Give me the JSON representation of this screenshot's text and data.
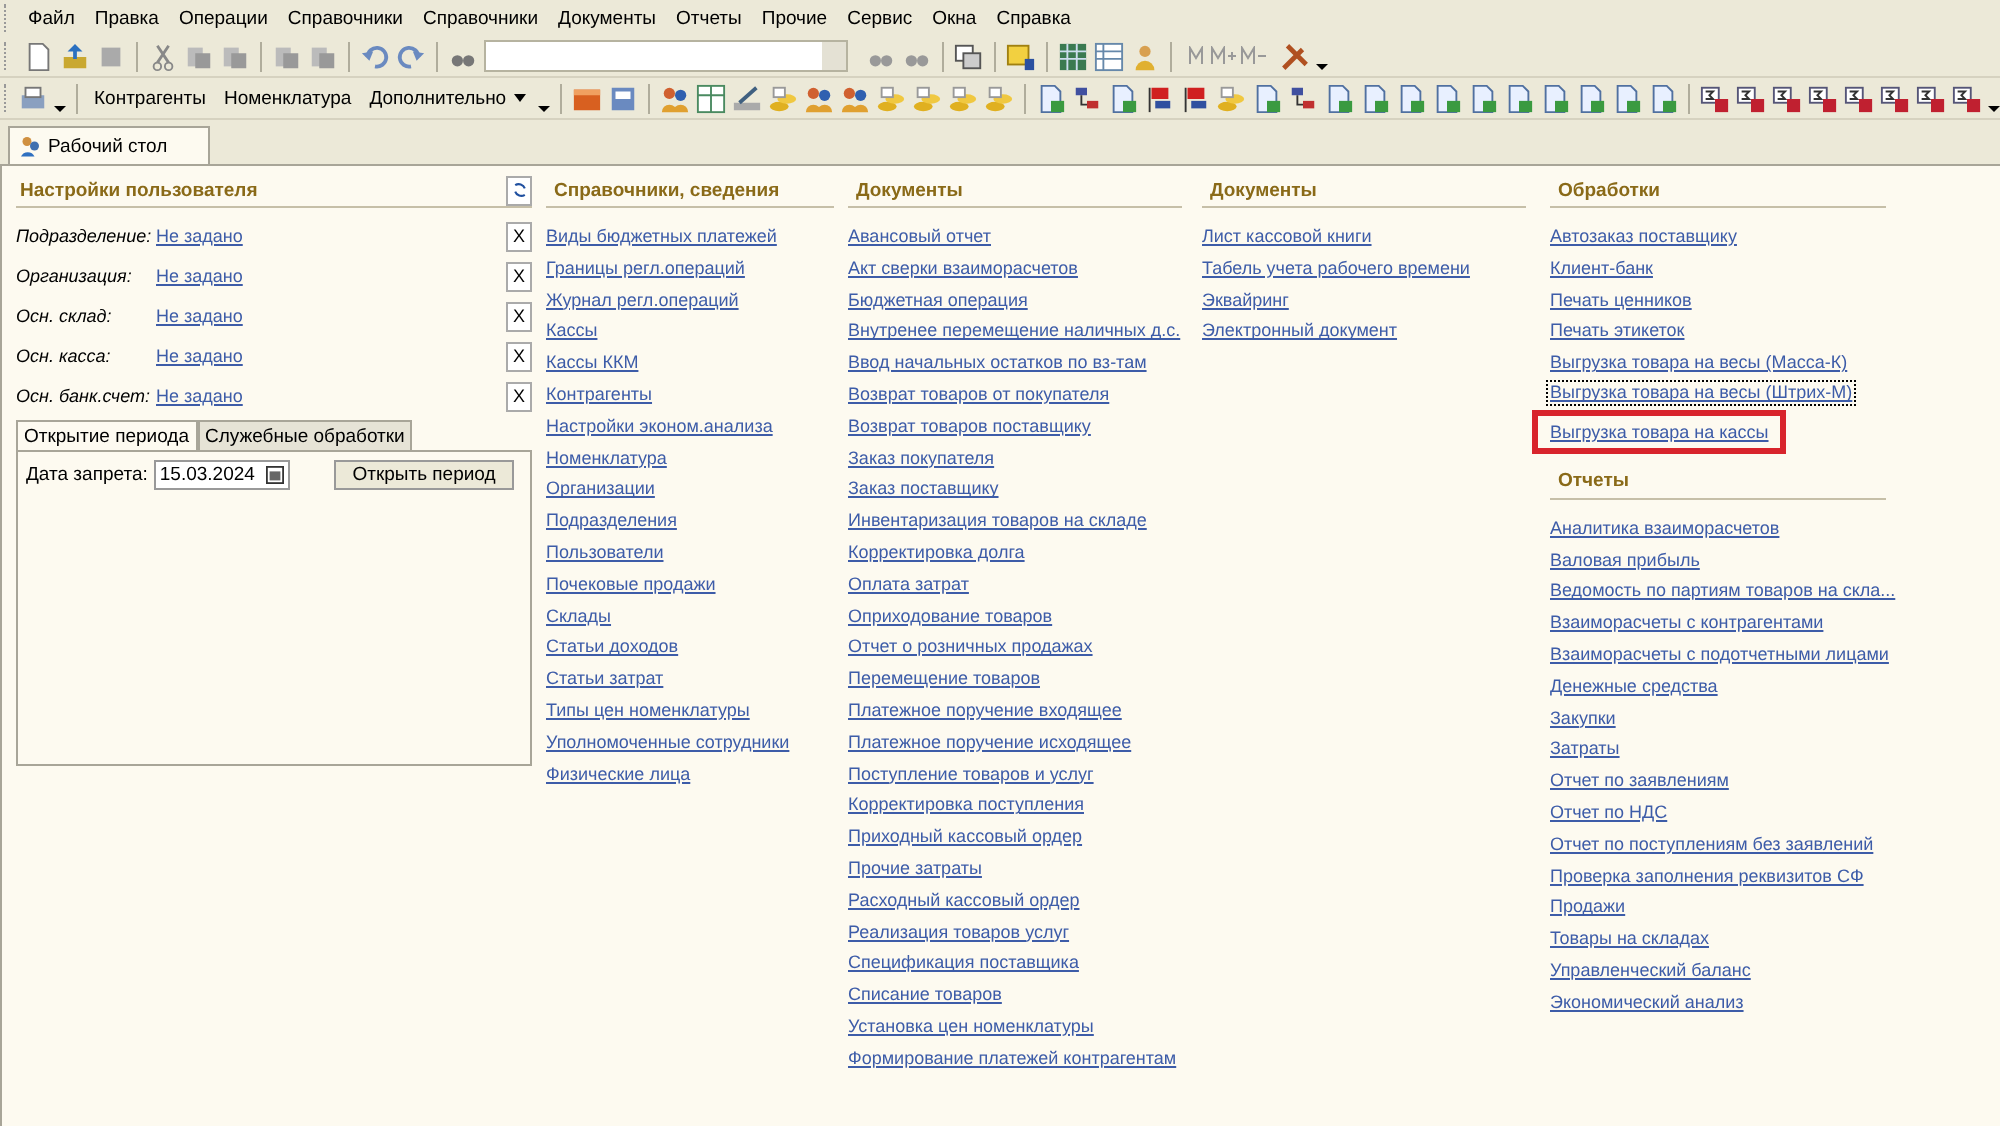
{
  "menu": [
    {
      "label": "Файл"
    },
    {
      "label": "Правка"
    },
    {
      "label": "Операции"
    },
    {
      "label": "Справочники"
    },
    {
      "label": "Справочники"
    },
    {
      "label": "Документы"
    },
    {
      "label": "Отчеты"
    },
    {
      "label": "Прочие"
    },
    {
      "label": "Сервис"
    },
    {
      "label": "Окна"
    },
    {
      "label": "Справка"
    }
  ],
  "quick_buttons": [
    "Контрагенты",
    "Номенклатура",
    "Дополнительно"
  ],
  "tabs": [
    {
      "label": "Рабочий стол",
      "selected": true
    }
  ],
  "user_settings": {
    "title": "Настройки пользователя",
    "fields": [
      {
        "label": "Подразделение:",
        "value": "Не задано",
        "clear": "X"
      },
      {
        "label": "Организация:",
        "value": "Не задано",
        "clear": "X"
      },
      {
        "label": "Осн. склад:",
        "value": "Не задано",
        "clear": "X"
      },
      {
        "label": "Осн. касса:",
        "value": "Не задано",
        "clear": "X"
      },
      {
        "label": "Осн. банк.счет:",
        "value": "Не задано",
        "clear": "X"
      }
    ],
    "inner_tabs": [
      {
        "label": "Открытие периода",
        "selected": true
      },
      {
        "label": "Служебные обработки",
        "selected": false
      }
    ],
    "date_label": "Дата запрета:",
    "date_value": "15.03.2024",
    "open_button": "Открыть период"
  },
  "columns": [
    {
      "sections": [
        {
          "title": "Справочники, сведения",
          "items": [
            {
              "label": "Виды бюджетных платежей"
            },
            {
              "label": "Границы регл.операций"
            },
            {
              "label": "Журнал регл.операций"
            },
            {
              "label": "Кассы"
            },
            {
              "label": "Кассы ККМ"
            },
            {
              "label": "Контрагенты"
            },
            {
              "label": "Настройки эконом.анализа"
            },
            {
              "label": "Номенклатура"
            },
            {
              "label": "Организации"
            },
            {
              "label": "Подразделения"
            },
            {
              "label": "Пользователи"
            },
            {
              "label": "Почековые продажи"
            },
            {
              "label": "Склады"
            },
            {
              "label": "Статьи доходов"
            },
            {
              "label": "Статьи затрат"
            },
            {
              "label": "Типы цен номенклатуры"
            },
            {
              "label": "Уполномоченные сотрудники"
            },
            {
              "label": "Физические лица"
            }
          ]
        }
      ]
    },
    {
      "sections": [
        {
          "title": "Документы",
          "items": [
            {
              "label": "Авансовый отчет"
            },
            {
              "label": "Акт сверки взаиморасчетов"
            },
            {
              "label": "Бюджетная операция"
            },
            {
              "label": "Внутренее перемещение наличных д.с."
            },
            {
              "label": "Ввод начальных остатков по вз-там"
            },
            {
              "label": "Возврат товаров от покупателя"
            },
            {
              "label": "Возврат товаров поставщику"
            },
            {
              "label": "Заказ покупателя"
            },
            {
              "label": "Заказ поставщику"
            },
            {
              "label": "Инвентаризация товаров на складе"
            },
            {
              "label": "Корректировка долга"
            },
            {
              "label": "Оплата затрат"
            },
            {
              "label": "Оприходование товаров"
            },
            {
              "label": "Отчет о розничных продажах"
            },
            {
              "label": "Перемещение товаров"
            },
            {
              "label": "Платежное поручение входящее"
            },
            {
              "label": "Платежное поручение исходящее"
            },
            {
              "label": "Поступление товаров и услуг"
            },
            {
              "label": "Корректировка поступления"
            },
            {
              "label": "Приходный кассовый ордер"
            },
            {
              "label": "Прочие затраты"
            },
            {
              "label": "Расходный кассовый ордер"
            },
            {
              "label": "Реализация товаров услуг"
            },
            {
              "label": "Спецификация поставщика"
            },
            {
              "label": "Списание товаров"
            },
            {
              "label": "Установка цен номенклатуры"
            },
            {
              "label": "Формирование платежей контрагентам"
            }
          ]
        }
      ]
    },
    {
      "sections": [
        {
          "title": "Документы",
          "items": [
            {
              "label": "Лист кассовой книги"
            },
            {
              "label": "Табель учета рабочего времени"
            },
            {
              "label": "Эквайринг"
            },
            {
              "label": "Электронный документ"
            }
          ]
        }
      ]
    },
    {
      "sections": [
        {
          "title": "Обработки",
          "items": [
            {
              "label": "Автозаказ поставщику",
              "highlighted": false,
              "focused": false
            },
            {
              "label": "Клиент-банк",
              "highlighted": false,
              "focused": false
            },
            {
              "label": "Печать ценников",
              "highlighted": false,
              "focused": false
            },
            {
              "label": "Печать этикеток",
              "highlighted": false,
              "focused": false
            },
            {
              "label": "Выгрузка товара на весы (Масса-К)",
              "highlighted": false,
              "focused": false
            },
            {
              "label": "Выгрузка товара на весы (Штрих-М)",
              "highlighted": false,
              "focused": true
            },
            {
              "label": "Выгрузка товара на кассы",
              "highlighted": true,
              "focused": false
            }
          ]
        },
        {
          "title": "Отчеты",
          "items": [
            {
              "label": "Аналитика взаиморасчетов"
            },
            {
              "label": "Валовая прибыль"
            },
            {
              "label": "Ведомость по партиям товаров на скла..."
            },
            {
              "label": "Взаиморасчеты с контрагентами"
            },
            {
              "label": "Взаиморасчеты с подотчетными лицами"
            },
            {
              "label": "Денежные средства"
            },
            {
              "label": "Закупки"
            },
            {
              "label": "Затраты"
            },
            {
              "label": "Отчет по заявлениям"
            },
            {
              "label": "Отчет по НДС"
            },
            {
              "label": "Отчет по поступлениям без заявлений"
            },
            {
              "label": "Проверка заполнения реквизитов СФ"
            },
            {
              "label": "Продажи"
            },
            {
              "label": "Товары на складах"
            },
            {
              "label": "Управленческий баланс"
            },
            {
              "label": "Экономический анализ"
            }
          ]
        }
      ]
    }
  ]
}
